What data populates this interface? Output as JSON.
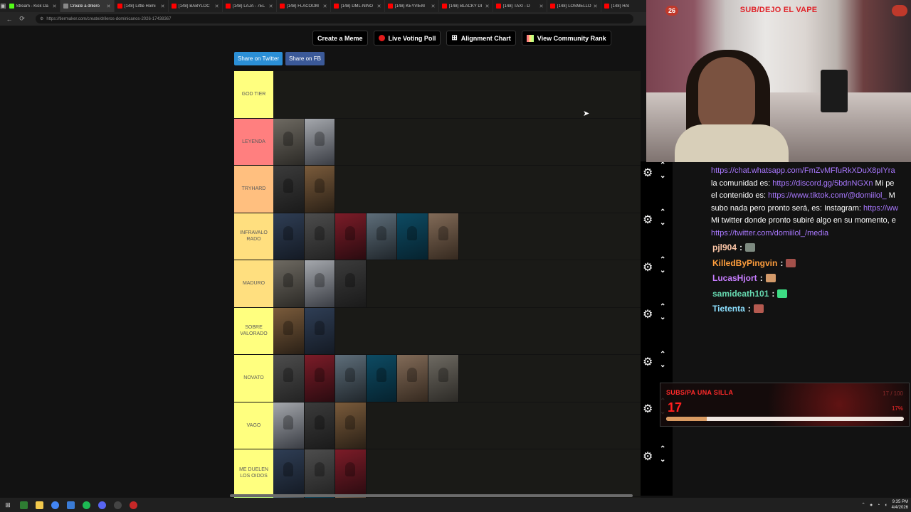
{
  "browser": {
    "tabs": [
      {
        "label": "Stream - Kick Da",
        "color": "#53fc18",
        "active": false
      },
      {
        "label": "Create a drilero",
        "color": "#888888",
        "active": true
      },
      {
        "label": "(148) Little Homi",
        "color": "#ff0000",
        "active": false
      },
      {
        "label": "(148) BABYLOC",
        "color": "#ff0000",
        "active": false
      },
      {
        "label": "(148) LAJA - 7EL",
        "color": "#ff0000",
        "active": false
      },
      {
        "label": "(148) FLACOOM",
        "color": "#ff0000",
        "active": false
      },
      {
        "label": "(148) DML-NIÑO",
        "color": "#ff0000",
        "active": false
      },
      {
        "label": "(148) KEYVIEM",
        "color": "#ff0000",
        "active": false
      },
      {
        "label": "(148) BLACKY DI",
        "color": "#ff0000",
        "active": false
      },
      {
        "label": "(148) TAXI - D",
        "color": "#ff0000",
        "active": false
      },
      {
        "label": "(148) LOSMELLO",
        "color": "#ff0000",
        "active": false
      },
      {
        "label": "(148) HAI",
        "color": "#ff0000",
        "active": false
      }
    ],
    "url": "https://tiermaker.com/create/drileros-dominicanos-2026-17438367"
  },
  "page": {
    "nav": {
      "create_meme": "Create a Meme",
      "live_poll": "Live Voting Poll",
      "alignment": "Alignment Chart",
      "community": "View Community Rank"
    },
    "share_twitter": "Share on Twitter",
    "share_fb": "Share on FB",
    "tiers": [
      {
        "label": "GOD TIER",
        "color": "#ffff7f",
        "thumbs": 0
      },
      {
        "label": "LEYENDA",
        "color": "#ff7f7f",
        "thumbs": 2
      },
      {
        "label": "TRYHARD",
        "color": "#ffbf7f",
        "thumbs": 2
      },
      {
        "label": "INFRAVALO RADO",
        "color": "#ffdf7f",
        "thumbs": 6
      },
      {
        "label": "MADURO",
        "color": "#ffdf7f",
        "thumbs": 3
      },
      {
        "label": "SOBRE VALORADO",
        "color": "#ffff7f",
        "thumbs": 2
      },
      {
        "label": "NOVATO",
        "color": "#ffff7f",
        "thumbs": 6
      },
      {
        "label": "VAGO",
        "color": "#ffff7f",
        "thumbs": 3
      },
      {
        "label": "ME DUELEN LOS OIDOS",
        "color": "#ffff7f",
        "thumbs": 3
      }
    ],
    "partial_tier": {
      "color": "#bfff7f",
      "thumbs": 3
    }
  },
  "overlay": {
    "cam_caption": "SUB/DEJO EL VAPE",
    "cam_badge": "26",
    "chat_lines": [
      {
        "text": "https://chat.whatsapp.com/FmZvMFfuRkXDuX8pIYra",
        "link": true
      },
      {
        "prefix": "la comunidad es: ",
        "link_text": "https://discord.gg/5bdnNGXn",
        "suffix": " Mi pe"
      },
      {
        "prefix": "el contenido es: ",
        "link_text": "https://www.tiktok.com/@domiilol_",
        "suffix": " M"
      },
      {
        "prefix": "subo nada pero pronto será, es: Instagram: ",
        "link_text": "https://ww",
        "suffix": ""
      },
      {
        "prefix": "Mi twitter donde pronto subiré algo en su momento, e",
        "link_text": "",
        "suffix": ""
      },
      {
        "text": "https://twitter.com/domiilol_/media",
        "link": true
      }
    ],
    "chat_users": [
      {
        "name": "pjl904",
        "color": "#ffc8a8",
        "emote": "#7d8a80"
      },
      {
        "name": "KilledByPingvin",
        "color": "#ff9e3d",
        "emote": "#a3504a"
      },
      {
        "name": "LucasHjort",
        "color": "#c77dff",
        "emote": "#d39a6a"
      },
      {
        "name": "samideath101",
        "color": "#66d9b0",
        "emote": "#3ddc84"
      },
      {
        "name": "Tietenta",
        "color": "#8ce0ff",
        "emote": "#b55a50"
      }
    ],
    "subgoal": {
      "title": "SUBS/PA UNA SILLA",
      "count": "17",
      "goal": "17 / 100",
      "percent_label": "17%",
      "percent": 17
    }
  },
  "taskbar": {
    "time": "9:35 PM",
    "date": "4/4/2026"
  }
}
